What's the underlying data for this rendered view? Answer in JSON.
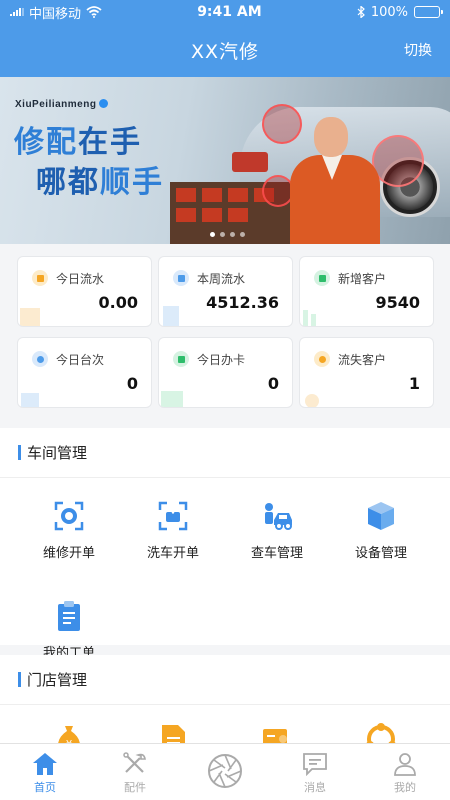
{
  "status_bar": {
    "carrier": "中国移动",
    "time": "9:41 AM",
    "battery": "100%"
  },
  "nav": {
    "title": "XX汽修",
    "switch_label": "切换"
  },
  "banner": {
    "brand": "XiuPeilianmeng",
    "slogan_line1": [
      "修配",
      "在手"
    ],
    "slogan_line2": [
      "哪都",
      "顺手"
    ],
    "slides": 4,
    "active_slide": 1
  },
  "stats": [
    {
      "label": "今日流水",
      "value": "0.00",
      "icon": "money-icon",
      "color": "#f5a623"
    },
    {
      "label": "本周流水",
      "value": "4512.36",
      "icon": "receipt-icon",
      "color": "#4d9be9"
    },
    {
      "label": "新增客户",
      "value": "9540",
      "icon": "bar-chart-icon",
      "color": "#2ebd6b"
    },
    {
      "label": "今日台次",
      "value": "0",
      "icon": "globe-icon",
      "color": "#4d9be9"
    },
    {
      "label": "今日办卡",
      "value": "0",
      "icon": "card-icon",
      "color": "#2ebd6b"
    },
    {
      "label": "流失客户",
      "value": "1",
      "icon": "users-icon",
      "color": "#f5a623"
    }
  ],
  "workshop": {
    "title": "车间管理",
    "items": [
      {
        "label": "维修开单",
        "icon": "repair-order-icon"
      },
      {
        "label": "洗车开单",
        "icon": "car-wash-icon"
      },
      {
        "label": "查车管理",
        "icon": "car-inspect-icon"
      },
      {
        "label": "设备管理",
        "icon": "equipment-box-icon"
      },
      {
        "label": "我的工单",
        "icon": "clipboard-icon"
      }
    ]
  },
  "store": {
    "title": "门店管理",
    "items": [
      {
        "icon": "money-bag-icon"
      },
      {
        "icon": "document-icon"
      },
      {
        "icon": "staff-card-icon"
      },
      {
        "icon": "people-circle-icon"
      }
    ]
  },
  "tabs": [
    {
      "label": "首页",
      "icon": "home-icon",
      "active": true
    },
    {
      "label": "配件",
      "icon": "tools-icon",
      "active": false
    },
    {
      "label": "",
      "icon": "aperture-icon",
      "active": false
    },
    {
      "label": "消息",
      "icon": "message-icon",
      "active": false
    },
    {
      "label": "我的",
      "icon": "user-icon",
      "active": false
    }
  ],
  "colors": {
    "primary": "#4d9be9",
    "accent": "#3d8ee8",
    "inactive": "#aaaaaa"
  }
}
